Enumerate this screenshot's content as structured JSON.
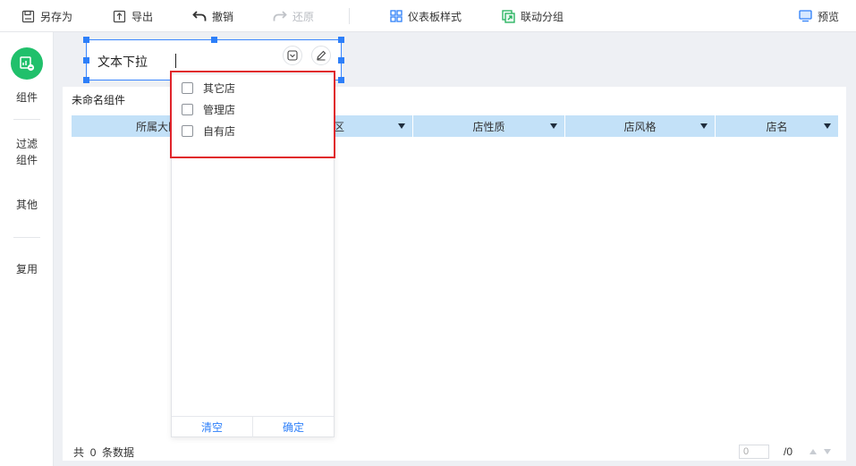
{
  "toolbar": {
    "save_as": "另存为",
    "export": "导出",
    "undo": "撤销",
    "redo": "还原",
    "dashboard_style": "仪表板样式",
    "linkage_group": "联动分组",
    "preview": "预览"
  },
  "sidebar": {
    "components": "组件",
    "filter_components_line1": "过滤",
    "filter_components_line2": "组件",
    "other": "其他",
    "reuse": "复用"
  },
  "filter_widget": {
    "label": "文本下拉",
    "value": ""
  },
  "dropdown": {
    "options": [
      "其它店",
      "管理店",
      "自有店"
    ],
    "clear_label": "清空",
    "confirm_label": "确定"
  },
  "table_widget": {
    "title": "未命名组件",
    "columns": [
      "所属大区",
      "区",
      "店性质",
      "店风格",
      "店名"
    ],
    "footer_prefix": "共",
    "row_count": "0",
    "footer_suffix": "条数据",
    "page_input_placeholder": "0",
    "page_total": "/0"
  },
  "colors": {
    "accent": "#2d7ff9",
    "component_icon_bg": "#20c06b",
    "table_header_bg": "#c3e1f8",
    "highlight": "#e0242b"
  },
  "icons": {
    "save_as": "save-as-icon",
    "export": "export-icon",
    "undo": "undo-icon",
    "redo": "redo-icon",
    "dashboard_style": "grid-style-icon",
    "linkage_group": "linkage-icon",
    "preview": "monitor-icon"
  }
}
